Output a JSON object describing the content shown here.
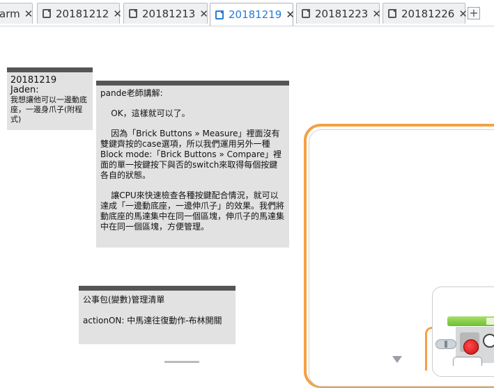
{
  "tabs": [
    {
      "label": "arm",
      "active": false
    },
    {
      "label": "20181212",
      "active": false
    },
    {
      "label": "20181213",
      "active": false
    },
    {
      "label": "20181219",
      "active": true
    },
    {
      "label": "20181223",
      "active": false
    },
    {
      "label": "20181226",
      "active": false
    }
  ],
  "tab_close_symbol": "✕",
  "add_tab_symbol": "+",
  "notes": {
    "note1": {
      "line1": "20181219",
      "line2": "Jaden:",
      "line3": "我想讓他可以一邊動底座，一邊身爪子(附程式)"
    },
    "note2": {
      "p1": "pande老師講解:",
      "p2": "    OK，這樣就可以了。",
      "p3": "    因為「Brick Buttons » Measure」裡面沒有雙鍵齊按的case選項，所以我們運用另外一種Block mode:「Brick Buttons » Compare」裡面的單一按鍵按下與否的switch來取得每個按鍵各自的狀態。",
      "p4": "    讓CPU來快速檢查各種按鍵配合情況，就可以達成「一邊動底座，一邊伸爪子」的效果。我們將動底座的馬達集中在同一個區塊，伸爪子的馬達集中在同一個區塊，方便管理。"
    },
    "note3": {
      "p1": "公事包(變數)管理清單",
      "p2": "actionON: 中馬達往復動作-布林開關"
    }
  },
  "colors": {
    "active_tab": "#2a7bd4",
    "note_bg": "#e2e2e2",
    "note_header": "#555555",
    "loop_frame": "#f3a145",
    "block_green": "#6fbf2e",
    "brick_button_red": "#d81b1b"
  },
  "icons": [
    "document-tab-icon",
    "close-icon",
    "plus-icon",
    "brick-buttons-icon",
    "gauge-icon",
    "scroll-down-icon"
  ]
}
